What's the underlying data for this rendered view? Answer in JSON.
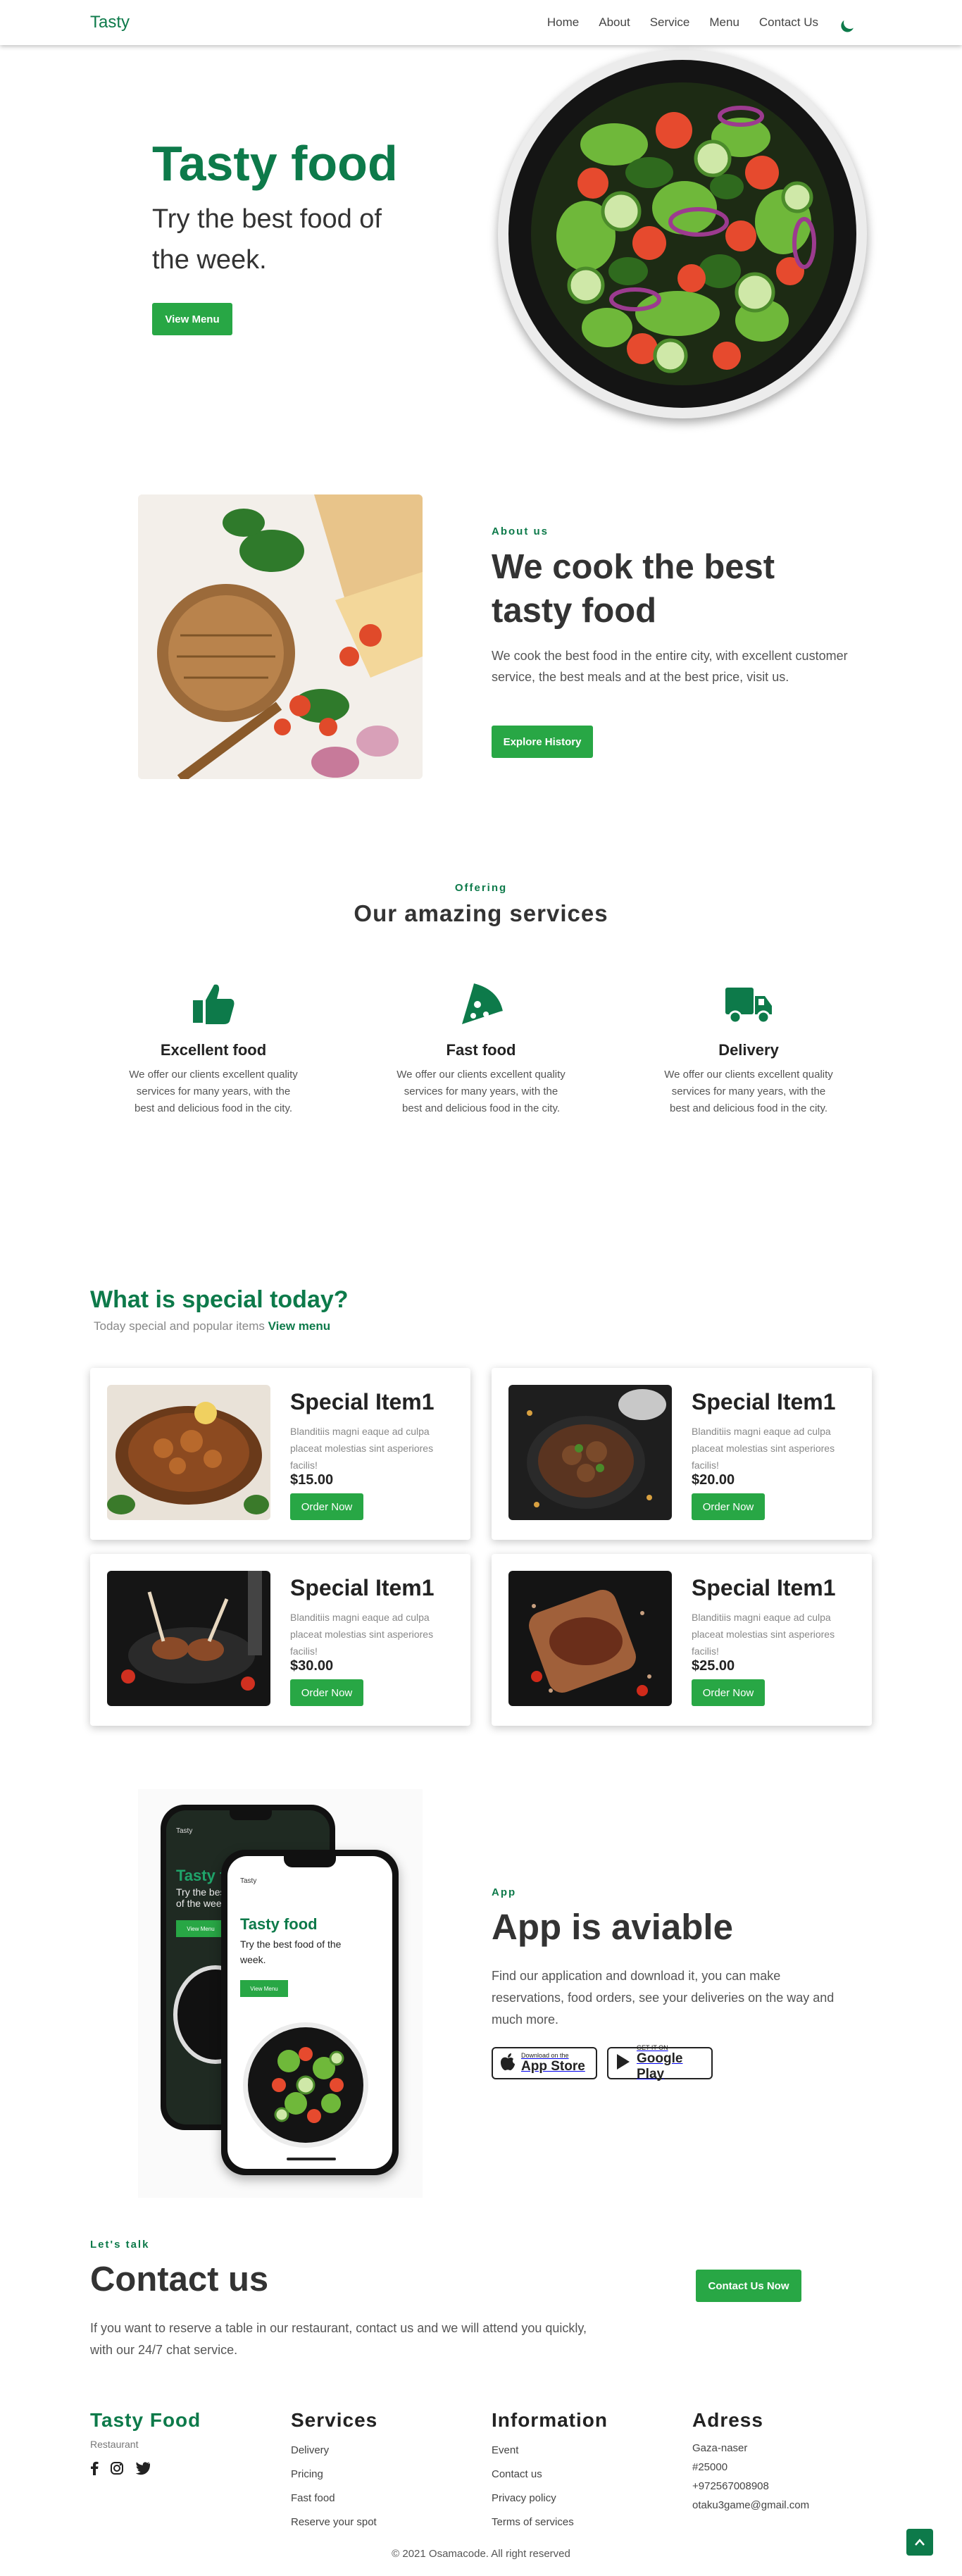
{
  "nav": {
    "brand": "Tasty",
    "links": [
      "Home",
      "About",
      "Service",
      "Menu",
      "Contact Us"
    ],
    "theme_icon": "moon-icon"
  },
  "hero": {
    "title": "Tasty food",
    "subtitle": "Try the best food of the week.",
    "button": "View Menu"
  },
  "about": {
    "kicker": "About us",
    "title": "We cook the best tasty food",
    "text": "We cook the best food in the entire city, with excellent customer service, the best meals and at the best price, visit us.",
    "button": "Explore History"
  },
  "services": {
    "kicker": "Offering",
    "title": "Our amazing services",
    "items": [
      {
        "icon": "thumbs-up-icon",
        "title": "Excellent food",
        "text": "We offer our clients excellent quality services for many years, with the best and delicious food in the city."
      },
      {
        "icon": "pizza-slice-icon",
        "title": "Fast food",
        "text": "We offer our clients excellent quality services for many years, with the best and delicious food in the city."
      },
      {
        "icon": "truck-icon",
        "title": "Delivery",
        "text": "We offer our clients excellent quality services for many years, with the best and delicious food in the city."
      }
    ]
  },
  "specials": {
    "title": "What is special today?",
    "subtitle": "Today special and popular items",
    "link": "View menu",
    "items": [
      {
        "name": "Special Item1",
        "desc": "Blanditiis magni eaque ad culpa placeat molestias sint asperiores facilis!",
        "price": "$15.00",
        "button": "Order Now"
      },
      {
        "name": "Special Item1",
        "desc": "Blanditiis magni eaque ad culpa placeat molestias sint asperiores facilis!",
        "price": "$20.00",
        "button": "Order Now"
      },
      {
        "name": "Special Item1",
        "desc": "Blanditiis magni eaque ad culpa placeat molestias sint asperiores facilis!",
        "price": "$30.00",
        "button": "Order Now"
      },
      {
        "name": "Special Item1",
        "desc": "Blanditiis magni eaque ad culpa placeat molestias sint asperiores facilis!",
        "price": "$25.00",
        "button": "Order Now"
      }
    ]
  },
  "app": {
    "kicker": "App",
    "title": "App is aviable",
    "text": "Find our application and download it, you can make reservations, food orders, see your deliveries on the way and much more.",
    "phone": {
      "brand": "Tasty",
      "title": "Tasty food",
      "subtitle": "Try the best food of the week.",
      "button": "View Menu"
    },
    "appstore": {
      "small": "Download on the",
      "big": "App Store"
    },
    "googleplay": {
      "small": "GET IT ON",
      "big": "Google Play"
    }
  },
  "contact": {
    "kicker": "Let's talk",
    "title": "Contact us",
    "text": "If you want to reserve a table in our restaurant, contact us and we will attend you quickly, with our 24/7 chat service.",
    "button": "Contact Us Now"
  },
  "footer": {
    "brand": "Tasty Food",
    "brand_sub": "Restaurant",
    "services_title": "Services",
    "services": [
      "Delivery",
      "Pricing",
      "Fast food",
      "Reserve your spot"
    ],
    "info_title": "Information",
    "info": [
      "Event",
      "Contact us",
      "Privacy policy",
      "Terms of services"
    ],
    "address_title": "Adress",
    "address": [
      "Gaza-naser",
      "#25000",
      "+972567008908",
      "otaku3game@gmail.com"
    ],
    "copyright": "© 2021 Osamacode. All right reserved"
  },
  "colors": {
    "primary": "#0d7a4a",
    "button": "#28a745"
  }
}
